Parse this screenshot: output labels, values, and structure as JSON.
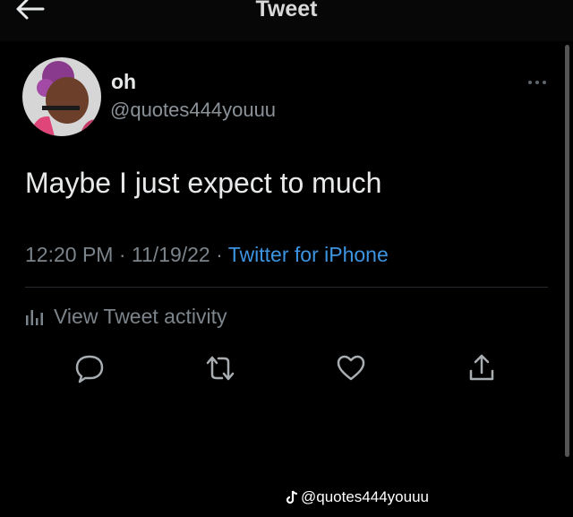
{
  "header": {
    "title": "Tweet"
  },
  "author": {
    "display_name": "oh",
    "handle": "@quotes444youuu"
  },
  "tweet": {
    "text": "Maybe I just expect to much",
    "time": "12:20 PM",
    "date": "11/19/22",
    "separator": "·",
    "source": "Twitter for iPhone"
  },
  "activity": {
    "label": "View Tweet activity"
  },
  "actions": [
    "reply-icon",
    "retweet-icon",
    "like-icon",
    "share-icon"
  ],
  "watermark": {
    "handle": "@quotes444youuu"
  },
  "colors": {
    "background": "#000000",
    "link": "#3d94e0",
    "muted": "#7c848b"
  }
}
